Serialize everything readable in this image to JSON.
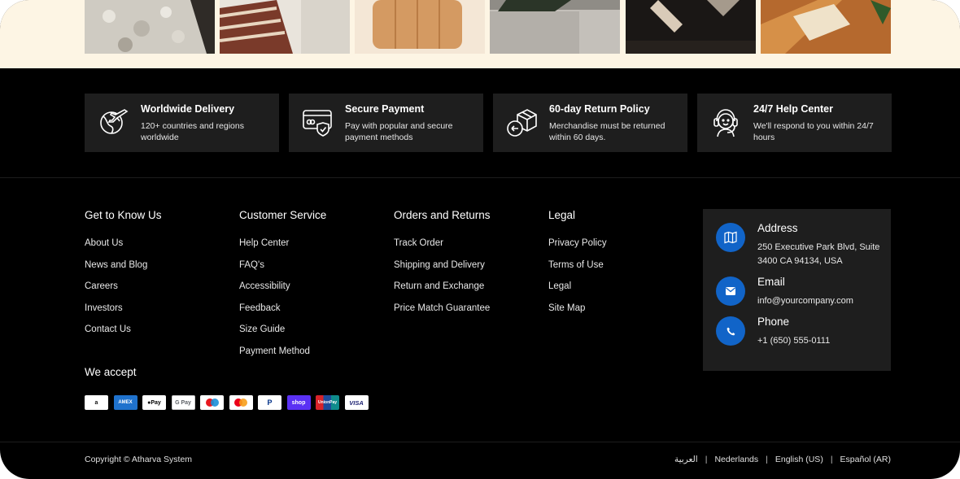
{
  "features": [
    {
      "title": "Worldwide Delivery",
      "desc": "120+ countries and regions worldwide",
      "icon": "globe-plane-icon"
    },
    {
      "title": "Secure Payment",
      "desc": "Pay with popular and secure payment methods",
      "icon": "secure-card-icon"
    },
    {
      "title": "60-day Return Policy",
      "desc": "Merchandise must be returned within 60 days.",
      "icon": "return-box-icon"
    },
    {
      "title": "24/7 Help Center",
      "desc": "We'll respond to you within 24/7 hours",
      "icon": "headset-support-icon"
    }
  ],
  "columns": [
    {
      "title": "Get to Know Us",
      "links": [
        "About Us",
        "News and Blog",
        "Careers",
        "Investors",
        "Contact Us"
      ]
    },
    {
      "title": "Customer Service",
      "links": [
        "Help Center",
        "FAQ's",
        "Accessibility",
        "Feedback",
        "Size Guide",
        "Payment Method"
      ]
    },
    {
      "title": "Orders and Returns",
      "links": [
        "Track Order",
        "Shipping and Delivery",
        "Return and Exchange",
        "Price Match Guarantee"
      ]
    },
    {
      "title": "Legal",
      "links": [
        "Privacy Policy",
        "Terms of Use",
        "Legal",
        "Site Map"
      ]
    }
  ],
  "we_accept": "We accept",
  "payment_methods": [
    {
      "name": "amazon-pay-icon",
      "label": "a",
      "bg": "#ffffff",
      "fg": "#111111"
    },
    {
      "name": "amex-icon",
      "label": "AMEX",
      "bg": "#1f72cd",
      "fg": "#ffffff"
    },
    {
      "name": "apple-pay-icon",
      "label": "Pay",
      "bg": "#ffffff",
      "fg": "#000000"
    },
    {
      "name": "google-pay-icon",
      "label": "G Pay",
      "bg": "#ffffff",
      "fg": "#5f6368"
    },
    {
      "name": "maestro-icon",
      "label": "",
      "bg": "#ffffff",
      "fg": "#000000"
    },
    {
      "name": "mastercard-icon",
      "label": "",
      "bg": "#ffffff",
      "fg": "#000000"
    },
    {
      "name": "paypal-icon",
      "label": "P",
      "bg": "#ffffff",
      "fg": "#003087"
    },
    {
      "name": "shop-pay-icon",
      "label": "shop",
      "bg": "#5a31f4",
      "fg": "#ffffff"
    },
    {
      "name": "unionpay-icon",
      "label": "UnionPay",
      "bg": "#0f8c8c",
      "fg": "#ffffff"
    },
    {
      "name": "visa-icon",
      "label": "VISA",
      "bg": "#ffffff",
      "fg": "#1a1f71"
    }
  ],
  "contact": {
    "address": {
      "title": "Address",
      "text": "250 Executive Park Blvd, Suite 3400 CA 94134, USA"
    },
    "email": {
      "title": "Email",
      "text": "info@yourcompany.com"
    },
    "phone": {
      "title": "Phone",
      "text": "+1 (650) 555-0111"
    }
  },
  "copyright": "Copyright © Atharva System",
  "languages": [
    "العربية",
    "Nederlands",
    "English (US)",
    "Español (AR)"
  ],
  "colors": {
    "accent": "#1164c8",
    "card": "#1e1e1e",
    "gallery_bg": "#fdf5e4"
  }
}
